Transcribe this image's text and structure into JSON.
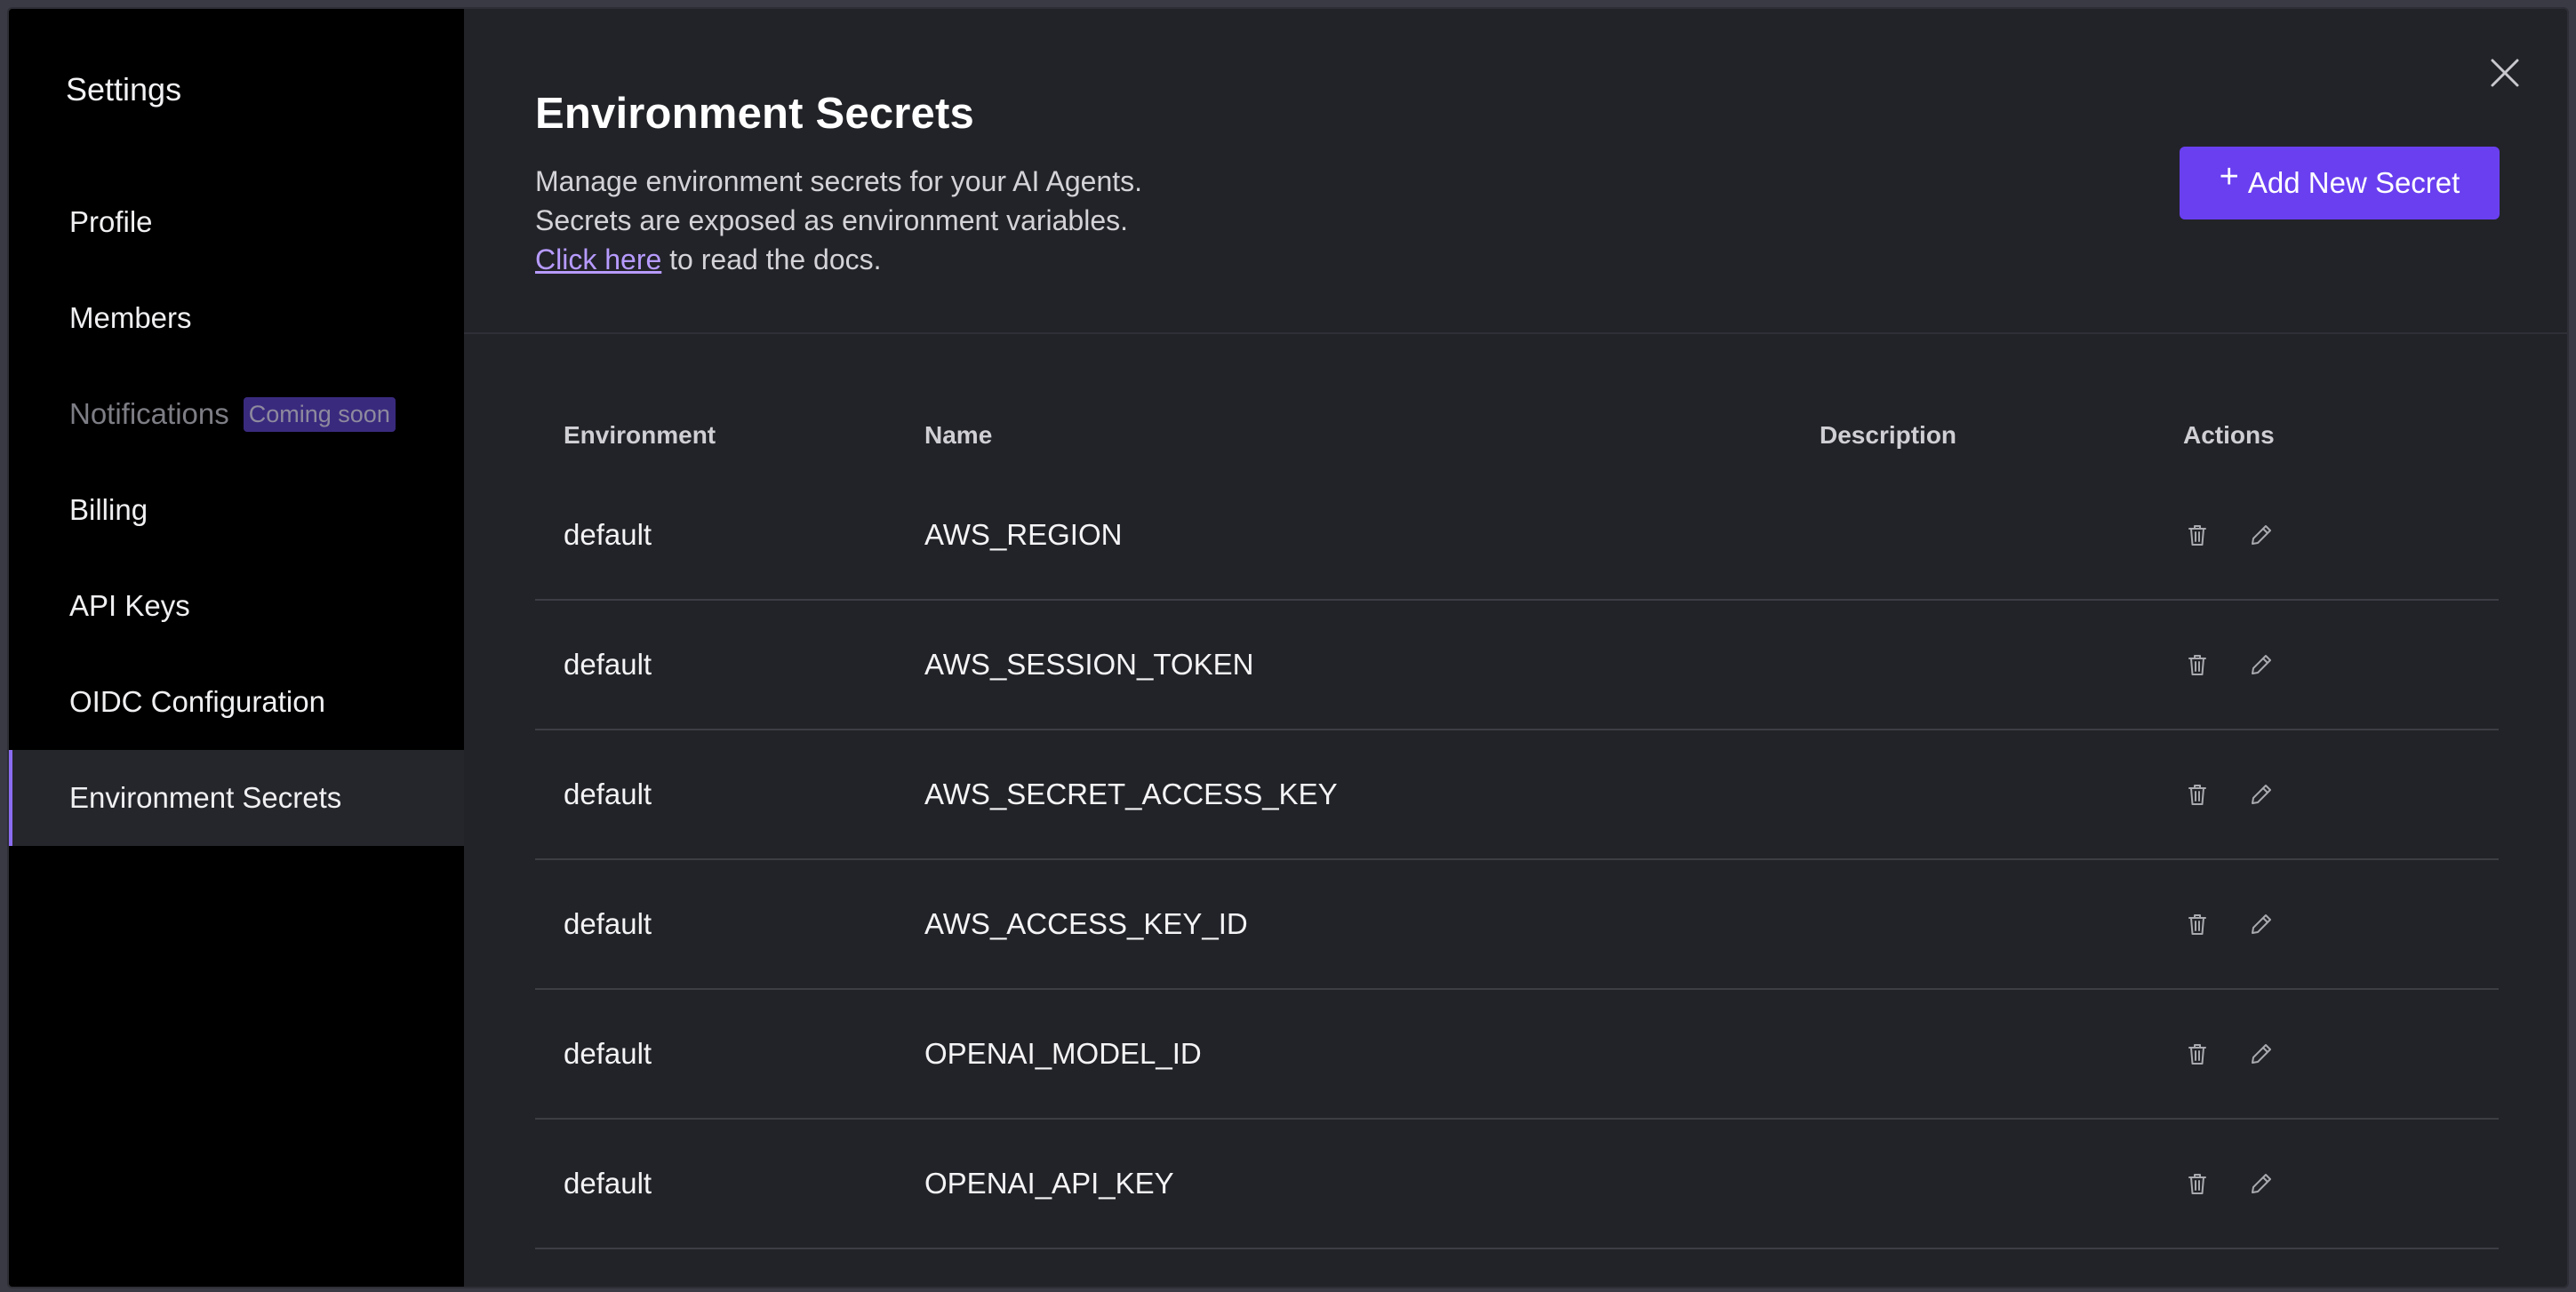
{
  "sidebar": {
    "title": "Settings",
    "items": [
      {
        "label": "Profile"
      },
      {
        "label": "Members"
      },
      {
        "label": "Notifications",
        "badge": "Coming soon"
      },
      {
        "label": "Billing"
      },
      {
        "label": "API Keys"
      },
      {
        "label": "OIDC Configuration"
      },
      {
        "label": "Environment Secrets"
      }
    ]
  },
  "header": {
    "title": "Environment Secrets",
    "line1": "Manage environment secrets for your AI Agents.",
    "line2": "Secrets are exposed as environment variables.",
    "link_text": "Click here",
    "link_suffix": " to read the docs.",
    "add_button": "Add New Secret"
  },
  "table": {
    "columns": [
      "Environment",
      "Name",
      "Description",
      "Actions"
    ],
    "rows": [
      {
        "environment": "default",
        "name": "AWS_REGION",
        "description": ""
      },
      {
        "environment": "default",
        "name": "AWS_SESSION_TOKEN",
        "description": ""
      },
      {
        "environment": "default",
        "name": "AWS_SECRET_ACCESS_KEY",
        "description": ""
      },
      {
        "environment": "default",
        "name": "AWS_ACCESS_KEY_ID",
        "description": ""
      },
      {
        "environment": "default",
        "name": "OPENAI_MODEL_ID",
        "description": ""
      },
      {
        "environment": "default",
        "name": "OPENAI_API_KEY",
        "description": ""
      }
    ]
  },
  "colors": {
    "accent": "#6a3ff0",
    "sidebar_bg": "#000000",
    "panel_bg": "#222328",
    "link": "#b79bff",
    "badge_bg": "#3a2a7e"
  },
  "icons": {
    "close": "close-icon",
    "delete": "trash-icon",
    "edit": "pencil-icon",
    "add": "plus-icon"
  }
}
